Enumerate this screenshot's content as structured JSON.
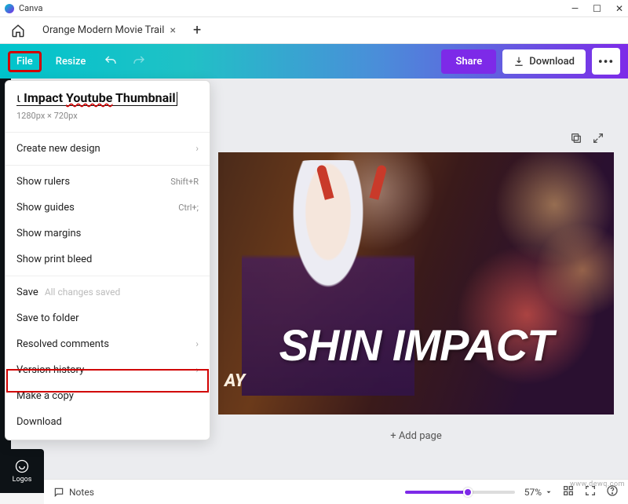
{
  "app": {
    "name": "Canva"
  },
  "window": {
    "min": "—",
    "max": "☐",
    "close": "✕"
  },
  "tabs": {
    "open": [
      {
        "title": "Orange Modern Movie Traile"
      }
    ],
    "add": "+"
  },
  "toolbar": {
    "file": "File",
    "resize": "Resize",
    "share": "Share",
    "download": "Download",
    "more": "•••"
  },
  "file_menu": {
    "title_prefix": "Impact ",
    "title_mid": "Youtube",
    "title_suffix": " Thumbnail",
    "dimensions": "1280px × 720px",
    "create": "Create new design",
    "rulers": {
      "label": "Show rulers",
      "shortcut": "Shift+R"
    },
    "guides": {
      "label": "Show guides",
      "shortcut": "Ctrl+;"
    },
    "margins": "Show margins",
    "bleed": "Show print bleed",
    "save": {
      "label": "Save",
      "note": "All changes saved"
    },
    "save_folder": "Save to folder",
    "resolved": "Resolved comments",
    "history": "Version history",
    "copy": "Make a copy",
    "download": "Download"
  },
  "sidebar": {
    "logos": "Logos"
  },
  "canvas": {
    "headline": "SHIN IMPACT",
    "sub": "AY",
    "add_page": "+ Add page"
  },
  "bottom": {
    "notes": "Notes",
    "zoom": "57%"
  },
  "watermark": "www.dewq.com"
}
